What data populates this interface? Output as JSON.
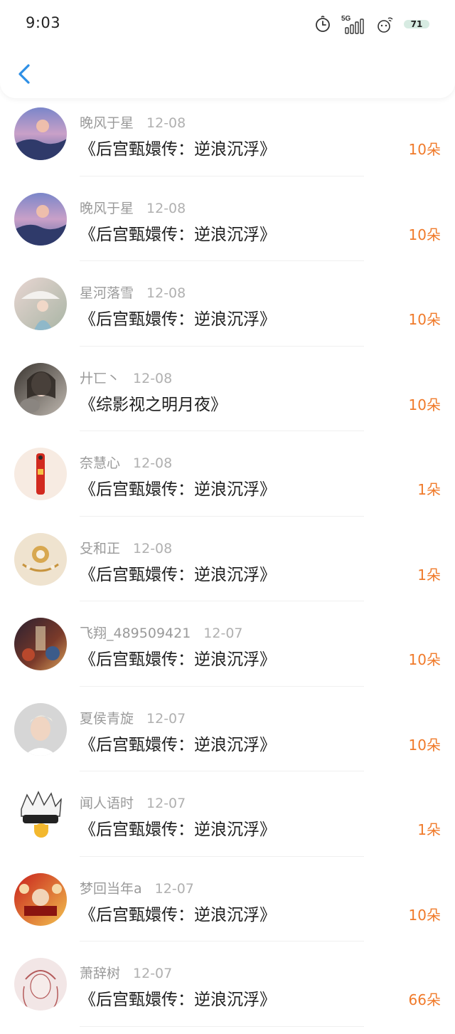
{
  "status_bar": {
    "time": "9:03",
    "network": "5G",
    "battery": "71"
  },
  "items": [
    {
      "user": "晚风于星",
      "date": "12-08",
      "book": "《后宫甄嬛传：逆浪沉浮》",
      "amount": "10朵",
      "avatar": "avatar-sunset"
    },
    {
      "user": "晚风于星",
      "date": "12-08",
      "book": "《后宫甄嬛传：逆浪沉浮》",
      "amount": "10朵",
      "avatar": "avatar-sunset"
    },
    {
      "user": "星河落雪",
      "date": "12-08",
      "book": "《后宫甄嬛传：逆浪沉浮》",
      "amount": "10朵",
      "avatar": "avatar-girl-umbrella"
    },
    {
      "user": "廾匸丶",
      "date": "12-08",
      "book": "《综影视之明月夜》",
      "amount": "10朵",
      "avatar": "avatar-girl-cat"
    },
    {
      "user": "奈慧心",
      "date": "12-08",
      "book": "《后宫甄嬛传：逆浪沉浮》",
      "amount": "1朵",
      "avatar": "avatar-red-amulet"
    },
    {
      "user": "殳和正",
      "date": "12-08",
      "book": "《后宫甄嬛传：逆浪沉浮》",
      "amount": "1朵",
      "avatar": "avatar-pearl-brooch"
    },
    {
      "user": "飞翔_489509421",
      "date": "12-07",
      "book": "《后宫甄嬛传：逆浪沉浮》",
      "amount": "10朵",
      "avatar": "avatar-movie-poster"
    },
    {
      "user": "夏侯青旋",
      "date": "12-07",
      "book": "《后宫甄嬛传：逆浪沉浮》",
      "amount": "10朵",
      "avatar": "avatar-blond-man"
    },
    {
      "user": "闻人语时",
      "date": "12-07",
      "book": "《后宫甄嬛传：逆浪沉浮》",
      "amount": "1朵",
      "avatar": "avatar-anime-blindfold"
    },
    {
      "user": "梦回当年a",
      "date": "12-07",
      "book": "《后宫甄嬛传：逆浪沉浮》",
      "amount": "10朵",
      "avatar": "avatar-red-poster"
    },
    {
      "user": "萧辞树",
      "date": "12-07",
      "book": "《后宫甄嬛传：逆浪沉浮》",
      "amount": "66朵",
      "avatar": "avatar-sketch-portrait"
    }
  ]
}
